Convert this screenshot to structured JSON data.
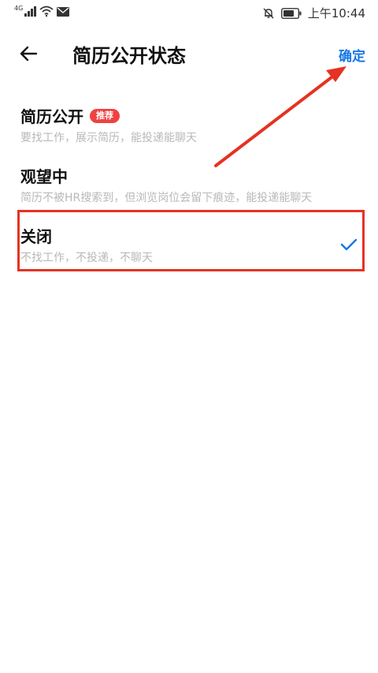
{
  "status_bar": {
    "network": "4G",
    "time": "上午10:44"
  },
  "header": {
    "title": "简历公开状态",
    "confirm_label": "确定"
  },
  "options": [
    {
      "title": "简历公开",
      "badge": "推荐",
      "desc": "要找工作，展示简历，能投递能聊天",
      "selected": false
    },
    {
      "title": "观望中",
      "desc": "简历不被HR搜索到，但浏览岗位会留下痕迹，能投递能聊天",
      "selected": false
    },
    {
      "title": "关闭",
      "desc": "不找工作，不投递，不聊天",
      "selected": true
    }
  ],
  "colors": {
    "accent": "#1677e5",
    "badge": "#f04141",
    "annotation": "#e53222",
    "desc_text": "#b8b8b8"
  },
  "icons": {
    "back": "arrow-left-icon",
    "check": "checkmark-icon"
  }
}
